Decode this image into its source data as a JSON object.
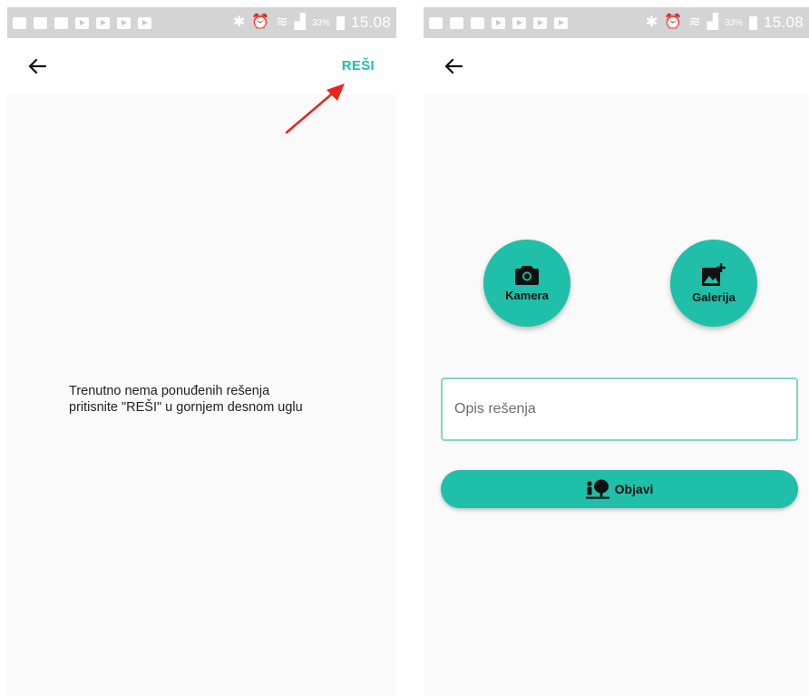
{
  "screens": [
    {
      "status_bar": {
        "battery": "33%",
        "time": "15.08"
      },
      "appbar": {
        "back_icon": "arrow-left-icon",
        "action_label": "REŠI"
      },
      "empty_state": {
        "line1": "Trenutno nema ponuđenih rešenja",
        "line2": "pritisnite \"REŠI\" u gornjem desnom uglu"
      },
      "annotation": {
        "arrow_color": "#e8241c"
      }
    },
    {
      "status_bar": {
        "battery": "33%",
        "time": "15.08"
      },
      "appbar": {
        "back_icon": "arrow-left-icon"
      },
      "camera_button": {
        "label": "Kamera",
        "icon": "camera-icon"
      },
      "gallery_button": {
        "label": "Galerija",
        "icon": "add-photo-icon"
      },
      "description_input": {
        "placeholder": "Opis rešenja",
        "value": ""
      },
      "publish_button": {
        "label": "Objavi",
        "icon": "person-tree-icon"
      }
    }
  ],
  "colors": {
    "accent": "#1fbfa9",
    "status_bar": "#d4d4d4",
    "content_bg": "#fafafa"
  }
}
